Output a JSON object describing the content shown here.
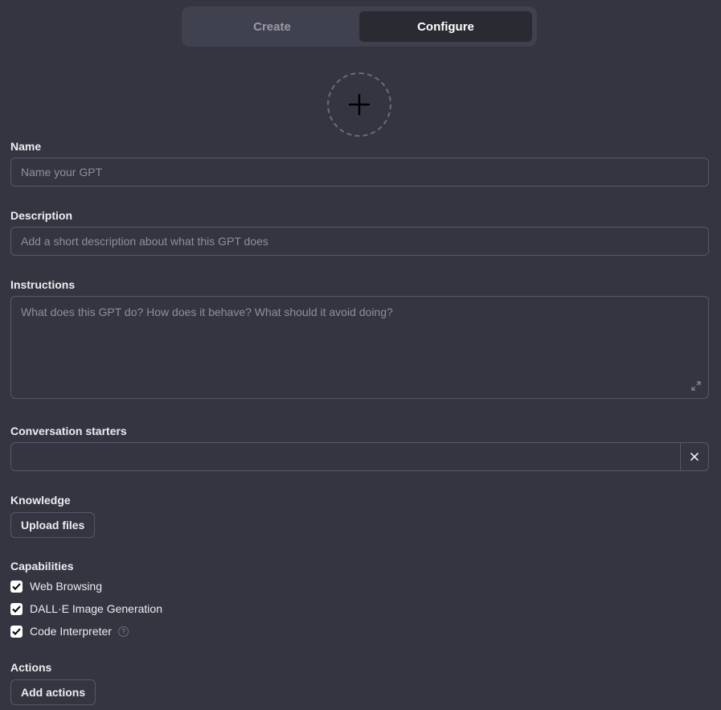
{
  "tabs": [
    {
      "label": "Create",
      "active": false
    },
    {
      "label": "Configure",
      "active": true
    }
  ],
  "avatar": {
    "icon": "plus-icon"
  },
  "name": {
    "label": "Name",
    "placeholder": "Name your GPT",
    "value": ""
  },
  "description": {
    "label": "Description",
    "placeholder": "Add a short description about what this GPT does",
    "value": ""
  },
  "instructions": {
    "label": "Instructions",
    "placeholder": "What does this GPT do? How does it behave? What should it avoid doing?",
    "value": "",
    "expand_icon": "expand-icon"
  },
  "conversation_starters": {
    "label": "Conversation starters",
    "items": [
      ""
    ],
    "remove_icon": "close-icon"
  },
  "knowledge": {
    "label": "Knowledge",
    "upload_label": "Upload files"
  },
  "capabilities": {
    "label": "Capabilities",
    "items": [
      {
        "label": "Web Browsing",
        "checked": true
      },
      {
        "label": "DALL·E Image Generation",
        "checked": true
      },
      {
        "label": "Code Interpreter",
        "checked": true,
        "help": "?"
      }
    ]
  },
  "actions": {
    "label": "Actions",
    "add_label": "Add actions"
  },
  "colors": {
    "background": "#343541",
    "border": "#565869",
    "text": "#ececf1",
    "placeholder": "#8e8ea0"
  }
}
